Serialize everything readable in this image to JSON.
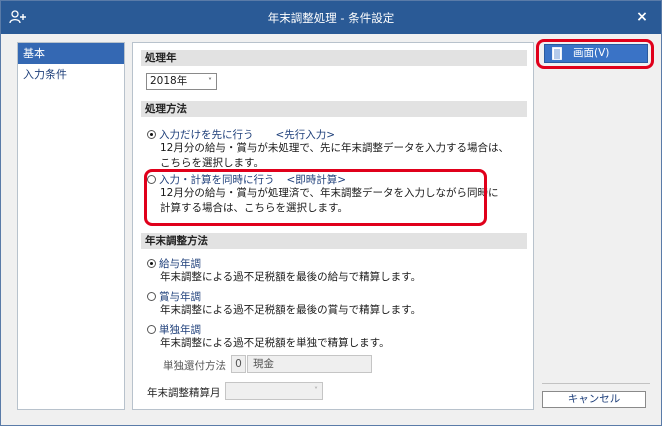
{
  "window": {
    "title": "年末調整処理 - 条件設定",
    "close_glyph": "×"
  },
  "sidebar": {
    "items": [
      {
        "label": "基本",
        "active": true
      },
      {
        "label": "入力条件",
        "active": false
      }
    ]
  },
  "fiscal_year": {
    "heading": "処理年",
    "selected": "2018年"
  },
  "processing_method": {
    "heading": "処理方法",
    "options": [
      {
        "label": "入力だけを先に行う",
        "tag": "<先行入力>",
        "checked": true,
        "desc_lines": [
          "12月分の給与・賞与が未処理で、先に年末調整データを入力する場合は、",
          "こちらを選択します。"
        ]
      },
      {
        "label": "入力・計算を同時に行う",
        "tag": "<即時計算>",
        "checked": false,
        "desc_lines": [
          "12月分の給与・賞与が処理済で、年末調整データを入力しながら同時に",
          "計算する場合は、こちらを選択します。"
        ]
      }
    ]
  },
  "adjustment_method": {
    "heading": "年末調整方法",
    "options": [
      {
        "label": "給与年調",
        "checked": true,
        "desc": "年末調整による過不足税額を最後の給与で精算します。"
      },
      {
        "label": "賞与年調",
        "checked": false,
        "desc": "年末調整による過不足税額を最後の賞与で精算します。"
      },
      {
        "label": "単独年調",
        "checked": false,
        "desc": "年末調整による過不足税額を単独で精算します。"
      }
    ],
    "refund_method_label": "単独還付方法",
    "refund_method_code": "0",
    "refund_method_value": "現金",
    "settlement_month_label": "年末調整精算月"
  },
  "actions": {
    "screen_button": "画面(V)",
    "cancel_button": "キャンセル"
  },
  "colors": {
    "titlebar": "#2a5a96",
    "accent": "#3468b3",
    "highlight": "#e0001b",
    "link_text": "#1e3f7a"
  }
}
